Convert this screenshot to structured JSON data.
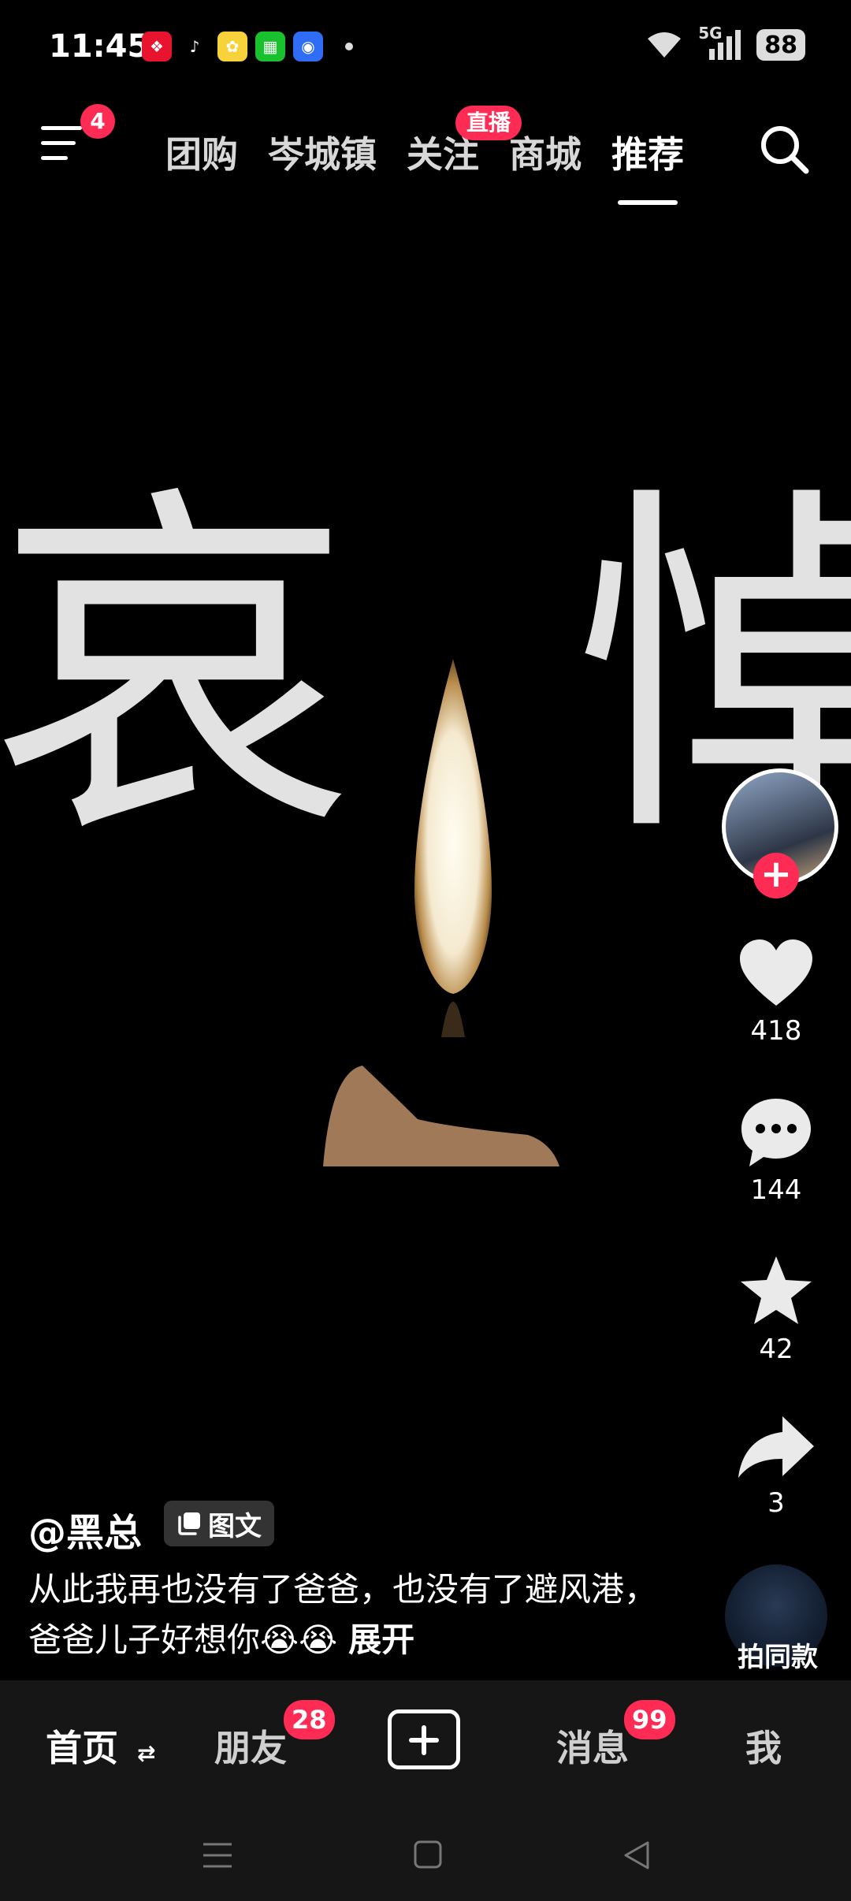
{
  "status_bar": {
    "time": "11:45",
    "network": "5G",
    "battery": "88"
  },
  "top_nav": {
    "menu_badge": "4",
    "tabs": [
      "团购",
      "岑城镇",
      "关注",
      "商城",
      "推荐"
    ],
    "active_tab": "推荐",
    "live_badge": "直播"
  },
  "video": {
    "text_left": "哀",
    "text_right": "悼"
  },
  "actions": {
    "likes": "418",
    "comments": "144",
    "favorites": "42",
    "shares": "3"
  },
  "post": {
    "author": "@黑总",
    "tag": "图文",
    "caption": "从此我再也没有了爸爸，也没有了避风港，爸爸儿子好想你😭😭",
    "expand": "展开",
    "same_style": "拍同款"
  },
  "bottom_nav": {
    "home": "首页",
    "friends": "朋友",
    "friends_badge": "28",
    "messages": "消息",
    "messages_badge": "99",
    "me": "我"
  },
  "colors": {
    "accent": "#fe2c55",
    "background": "#000000",
    "nav_bg": "#161616"
  }
}
